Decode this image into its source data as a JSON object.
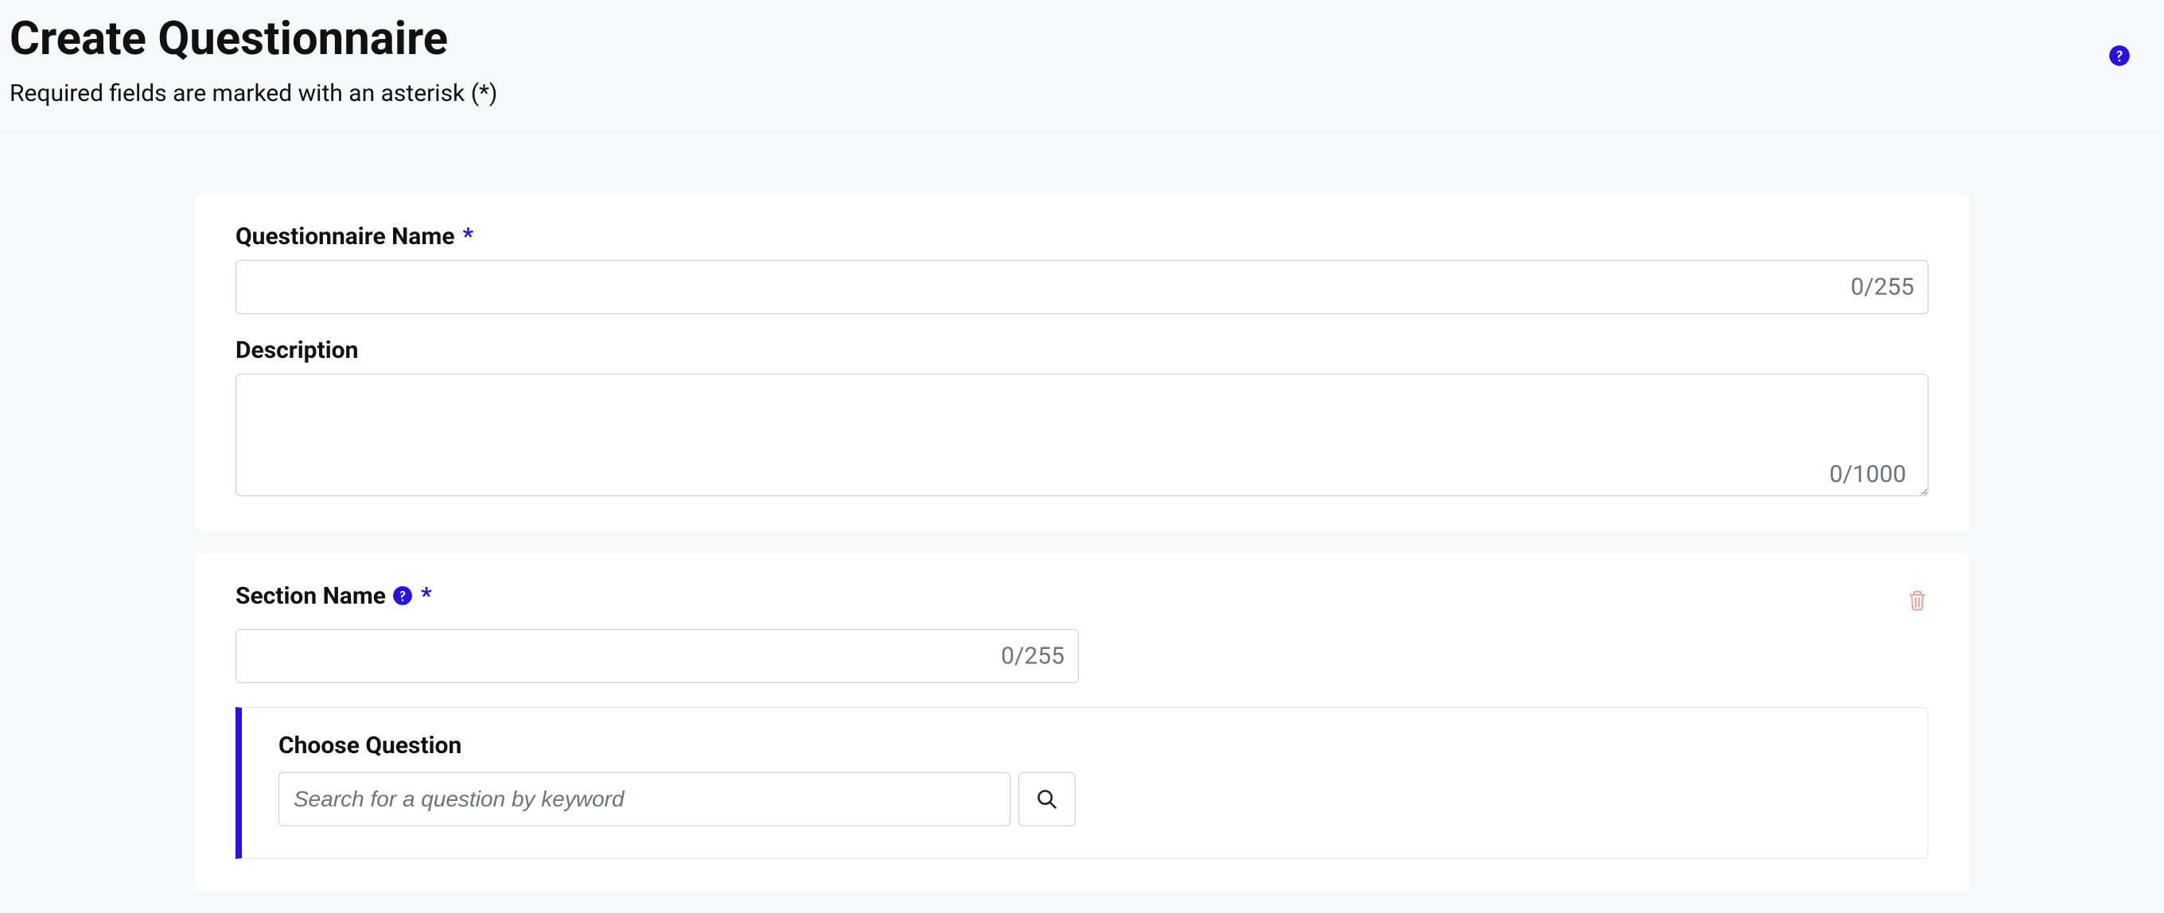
{
  "page": {
    "title": "Create Questionnaire",
    "subtitle": "Required fields are marked with an asterisk (*)"
  },
  "form": {
    "name": {
      "label": "Questionnaire Name",
      "required_marker": "*",
      "value": "",
      "counter": "0/255"
    },
    "description": {
      "label": "Description",
      "value": "",
      "counter": "0/1000"
    }
  },
  "section": {
    "name": {
      "label": "Section Name",
      "required_marker": "*",
      "value": "",
      "counter": "0/255"
    },
    "question": {
      "label": "Choose Question",
      "search_placeholder": "Search for a question by keyword"
    }
  }
}
